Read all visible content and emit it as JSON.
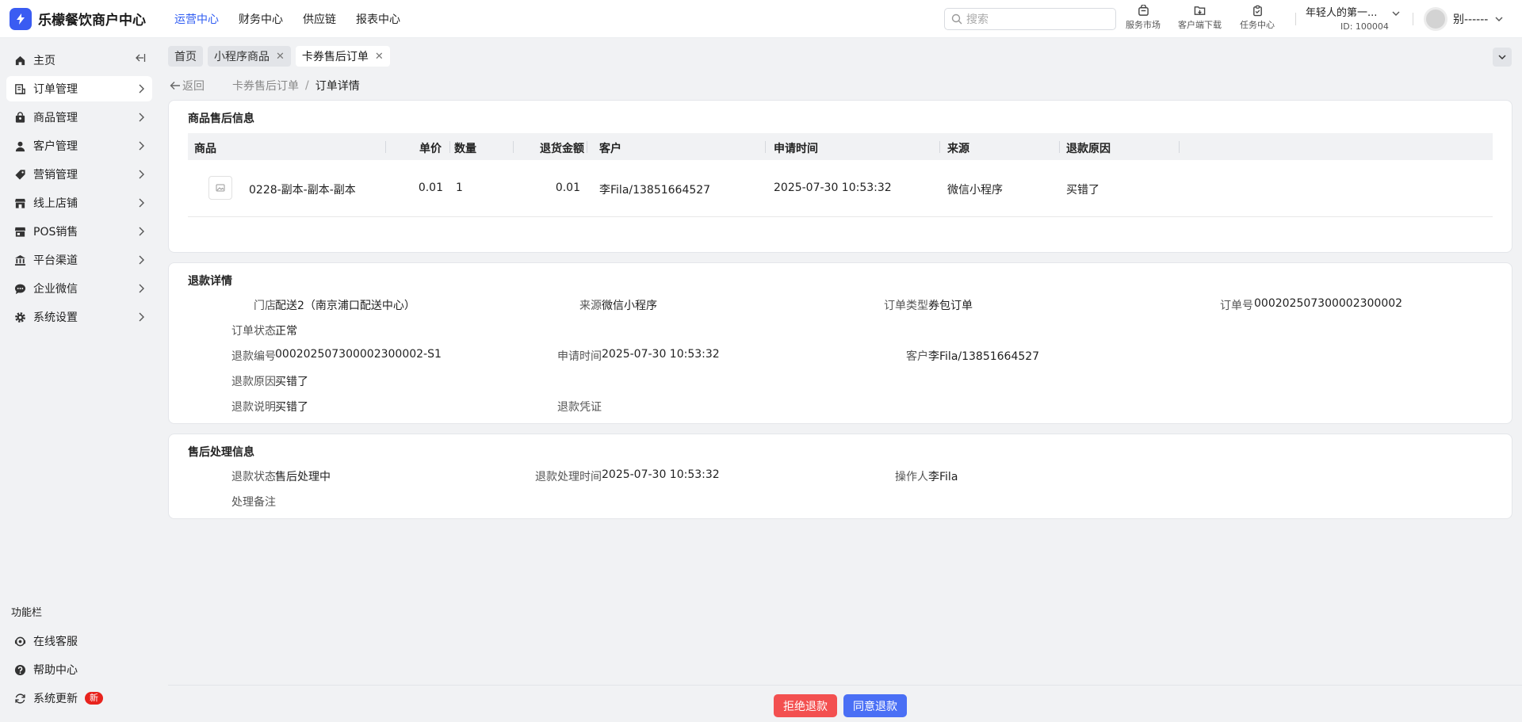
{
  "app": {
    "title": "乐檬餐饮商户中心"
  },
  "topnav": [
    {
      "label": "运营中心",
      "active": true
    },
    {
      "label": "财务中心",
      "active": false
    },
    {
      "label": "供应链",
      "active": false
    },
    {
      "label": "报表中心",
      "active": false
    }
  ],
  "search": {
    "placeholder": "搜索"
  },
  "tools": {
    "market": "服务市场",
    "download": "客户端下载",
    "tasks": "任务中心"
  },
  "account": {
    "name": "年轻人的第一...",
    "id": "ID: 100004"
  },
  "user": {
    "name": "别------"
  },
  "sidebar": {
    "items": [
      {
        "label": "主页",
        "icon": "home-icon"
      },
      {
        "label": "订单管理",
        "icon": "order-icon"
      },
      {
        "label": "商品管理",
        "icon": "goods-icon"
      },
      {
        "label": "客户管理",
        "icon": "user-icon"
      },
      {
        "label": "营销管理",
        "icon": "tag-icon"
      },
      {
        "label": "线上店铺",
        "icon": "store-icon"
      },
      {
        "label": "POS销售",
        "icon": "pos-icon"
      },
      {
        "label": "平台渠道",
        "icon": "bank-icon"
      },
      {
        "label": "企业微信",
        "icon": "chat-icon"
      },
      {
        "label": "系统设置",
        "icon": "gear-icon"
      }
    ],
    "func_title": "功能栏",
    "func_items": [
      {
        "label": "在线客服",
        "icon": "support-icon"
      },
      {
        "label": "帮助中心",
        "icon": "help-icon"
      },
      {
        "label": "系统更新",
        "icon": "refresh-icon",
        "badge": "新"
      }
    ]
  },
  "tabs": [
    {
      "label": "首页",
      "closable": false
    },
    {
      "label": "小程序商品",
      "closable": true
    },
    {
      "label": "卡券售后订单",
      "closable": true,
      "active": true
    }
  ],
  "breadcrumb": {
    "back": "返回",
    "parent": "卡券售后订单",
    "current": "订单详情"
  },
  "goods_section": {
    "title": "商品售后信息",
    "columns": [
      "商品",
      "单价",
      "数量",
      "退货金额",
      "客户",
      "申请时间",
      "来源",
      "退款原因"
    ],
    "rows": [
      {
        "product": "0228-副本-副本-副本",
        "price": "0.01",
        "qty": "1",
        "amount": "0.01",
        "customer": "李Fila/13851664527",
        "apply_time": "2025-07-30 10:53:32",
        "source": "微信小程序",
        "reason": "买错了"
      }
    ]
  },
  "refund_section": {
    "title": "退款详情",
    "fields": {
      "store": {
        "label": "门店",
        "value": "配送2（南京浦口配送中心）"
      },
      "source": {
        "label": "来源",
        "value": "微信小程序"
      },
      "order_type": {
        "label": "订单类型",
        "value": "券包订单"
      },
      "order_no": {
        "label": "订单号",
        "value": "000202507300002300002"
      },
      "order_status": {
        "label": "订单状态",
        "value": "正常"
      },
      "refund_no": {
        "label": "退款编号",
        "value": "000202507300002300002-S1"
      },
      "apply_time": {
        "label": "申请时间",
        "value": "2025-07-30 10:53:32"
      },
      "customer": {
        "label": "客户",
        "value": "李Fila/13851664527"
      },
      "refund_reason": {
        "label": "退款原因",
        "value": "买错了"
      },
      "refund_desc": {
        "label": "退款说明",
        "value": "买错了"
      },
      "refund_proof": {
        "label": "退款凭证",
        "value": ""
      }
    }
  },
  "process_section": {
    "title": "售后处理信息",
    "fields": {
      "refund_status": {
        "label": "退款状态",
        "value": "售后处理中"
      },
      "process_time": {
        "label": "退款处理时间",
        "value": "2025-07-30 10:53:32"
      },
      "operator": {
        "label": "操作人",
        "value": "李Fila"
      },
      "remark": {
        "label": "处理备注",
        "value": ""
      }
    }
  },
  "actions": {
    "reject": "拒绝退款",
    "agree": "同意退款"
  },
  "colors": {
    "primary": "#3a5cf2",
    "danger": "#f35050",
    "agree": "#4a6ff5"
  }
}
